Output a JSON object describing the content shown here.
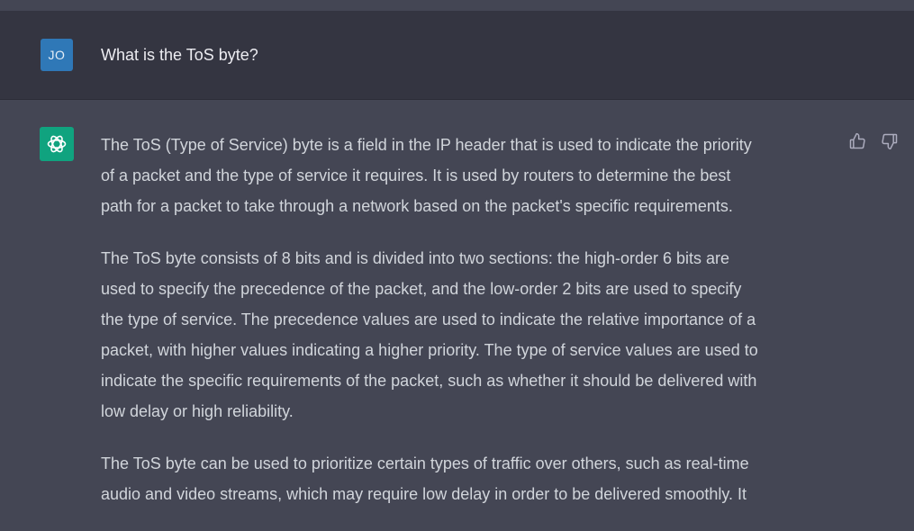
{
  "conversation": {
    "user": {
      "avatar_initials": "JO",
      "message": "What is the ToS byte?"
    },
    "assistant": {
      "avatar_icon": "openai-logo-icon",
      "paragraphs": [
        {
          "lines": [
            "The ToS (Type of Service) byte is a field in the IP header that is used to indicate the priority",
            "of a packet and the type of service it requires. It is used by routers to determine the best",
            "path for a packet to take through a network based on the packet's specific requirements."
          ]
        },
        {
          "lines": [
            "The ToS byte consists of 8 bits and is divided into two sections: the high-order 6 bits are",
            "used to specify the precedence of the packet, and the low-order 2 bits are used to specify",
            "the type of service. The precedence values are used to indicate the relative importance of a",
            "packet, with higher values indicating a higher priority. The type of service values are used to",
            "indicate the specific requirements of the packet, such as whether it should be delivered with",
            "low delay or high reliability."
          ]
        },
        {
          "lines": [
            "The ToS byte can be used to prioritize certain types of traffic over others, such as real-time",
            "audio and video streams, which may require low delay in order to be delivered smoothly. It"
          ]
        }
      ],
      "feedback": {
        "thumbs_up_icon": "thumbs-up-icon",
        "thumbs_down_icon": "thumbs-down-icon"
      }
    }
  },
  "colors": {
    "user_row_bg": "#343541",
    "assistant_row_bg": "#444654",
    "user_avatar_bg": "#2f78b7",
    "bot_avatar_bg": "#10a37f",
    "text_primary": "#ececf1",
    "text_secondary": "#d1d5db"
  }
}
